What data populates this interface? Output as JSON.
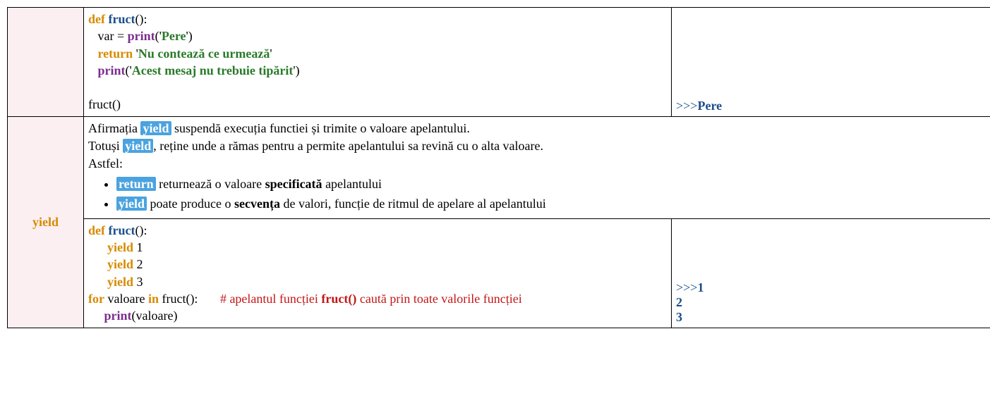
{
  "row1": {
    "label": "",
    "code": {
      "def": "def",
      "fname": "fruct",
      "parens1": "():",
      "line2_pre": "   var = ",
      "print1": "print",
      "line2_open": "('",
      "str1": "Pere",
      "line2_close": "')",
      "return": "return",
      "str2_open": " '",
      "str2": "Nu contează ce urmează",
      "str2_close": "'",
      "print2": "print",
      "line4_open": "('",
      "str3": "Acest mesaj nu trebuie tipărit",
      "line4_close": "')",
      "call": "fruct()"
    },
    "out": {
      "prompt": ">>>",
      "val": "Pere"
    }
  },
  "row2": {
    "label": "yield",
    "desc": {
      "p1a": "Afirmația ",
      "hl1": "yield",
      "p1b": " suspendă execuția functiei și trimite o valoare apelantului.",
      "p2a": "Totuși ",
      "hl2": "yield",
      "p2b": ",  reține unde a rămas pentru a permite apelantului sa revină cu o alta valoare.",
      "p3": "Astfel:",
      "li1_hl": "return",
      "li1a": " returnează o valoare ",
      "li1b": "specificată",
      "li1c": " apelantului",
      "li2_hl": "yield",
      "li2a": " poate produce o ",
      "li2b": "secvența",
      "li2c": " de valori, funcție de ritmul de apelare al apelantului"
    },
    "code": {
      "def": "def",
      "fname": "fruct",
      "parens1": "():",
      "yield": "yield",
      "y1": "1",
      "y2": "2",
      "y3": "3",
      "for": "for",
      "var": " valoare ",
      "in": "in",
      "call": " fruct():       ",
      "comment_pre": "# apelantul funcției ",
      "comment_fn": "fruct()",
      "comment_post": " caută prin toate valorile funcției",
      "print": "print",
      "print_arg": "(valoare)"
    },
    "out": {
      "prompt": ">>>",
      "v1": "1",
      "v2": "2",
      "v3": "3"
    }
  }
}
